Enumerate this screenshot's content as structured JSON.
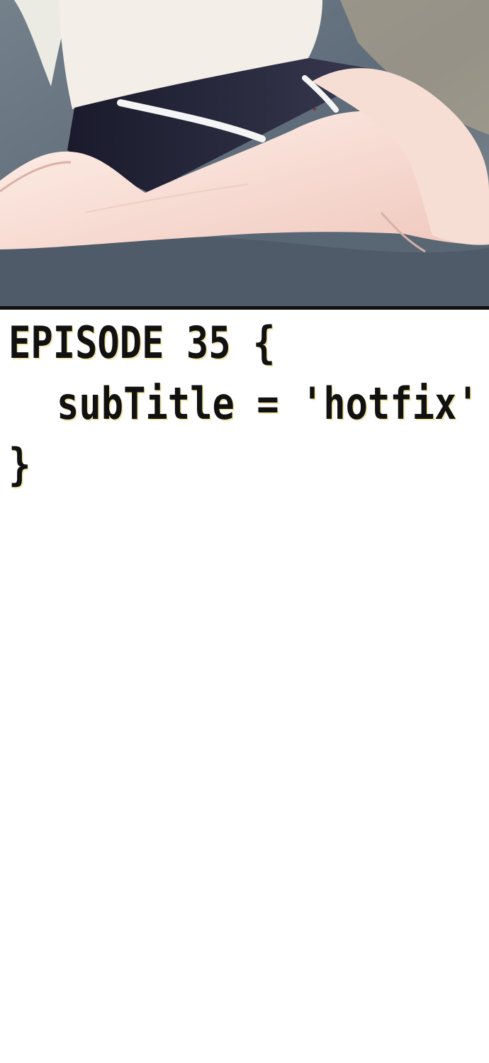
{
  "panel": {
    "scene_icon": "illustrated-legs-on-sofa-icon"
  },
  "title": {
    "line1": "EPISODE 35 {",
    "line2": "subTitle = 'hotfix'",
    "line3": "}"
  },
  "colors": {
    "sofa": "#5d6a78",
    "shorts": "#24243a",
    "skin": "#f7ded5",
    "shirt": "#f4eee8",
    "text": "#111111",
    "text_shadow": "#f2e6a7",
    "background": "#ffffff"
  }
}
